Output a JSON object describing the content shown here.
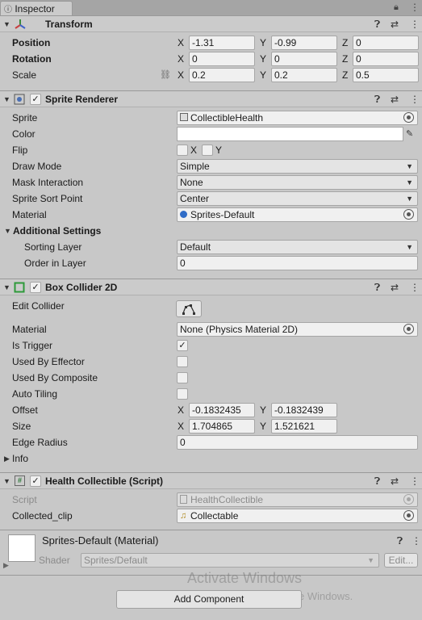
{
  "window": {
    "tab_label": "Inspector"
  },
  "transform": {
    "title": "Transform",
    "rows": [
      {
        "label": "Position",
        "x": "-1.31",
        "y": "-0.99",
        "z": "0"
      },
      {
        "label": "Rotation",
        "x": "0",
        "y": "0",
        "z": "0"
      },
      {
        "label": "Scale",
        "x": "0.2",
        "y": "0.2",
        "z": "0.5"
      }
    ],
    "axis": {
      "x": "X",
      "y": "Y",
      "z": "Z"
    }
  },
  "sprite_renderer": {
    "title": "Sprite Renderer",
    "sprite_label": "Sprite",
    "sprite_value": "CollectibleHealth",
    "color_label": "Color",
    "flip_label": "Flip",
    "flip_x": "X",
    "flip_y": "Y",
    "draw_mode_label": "Draw Mode",
    "draw_mode_value": "Simple",
    "mask_label": "Mask Interaction",
    "mask_value": "None",
    "sort_point_label": "Sprite Sort Point",
    "sort_point_value": "Center",
    "material_label": "Material",
    "material_value": "Sprites-Default",
    "additional_label": "Additional Settings",
    "sorting_layer_label": "Sorting Layer",
    "sorting_layer_value": "Default",
    "order_label": "Order in Layer",
    "order_value": "0"
  },
  "box_collider": {
    "title": "Box Collider 2D",
    "edit_label": "Edit Collider",
    "material_label": "Material",
    "material_value": "None (Physics Material 2D)",
    "trigger_label": "Is Trigger",
    "effector_label": "Used By Effector",
    "composite_label": "Used By Composite",
    "tiling_label": "Auto Tiling",
    "offset_label": "Offset",
    "offset_x": "-0.1832435",
    "offset_y": "-0.1832439",
    "size_label": "Size",
    "size_x": "1.704865",
    "size_y": "1.521621",
    "edge_label": "Edge Radius",
    "edge_value": "0",
    "info_label": "Info"
  },
  "script_comp": {
    "title": "Health Collectible (Script)",
    "script_label": "Script",
    "script_value": "HealthCollectible",
    "clip_label": "Collected_clip",
    "clip_value": "Collectable"
  },
  "material_panel": {
    "title": "Sprites-Default (Material)",
    "shader_label": "Shader",
    "shader_value": "Sprites/Default",
    "edit_label": "Edit..."
  },
  "footer": {
    "add_component": "Add Component",
    "watermark_title": "Activate Windows",
    "watermark_sub": "Go to Settings to activate Windows."
  },
  "colors": {
    "panel_bg": "#c8c8c8",
    "header_bg": "#cbcbcb",
    "field_bg": "#f0f0f0"
  }
}
